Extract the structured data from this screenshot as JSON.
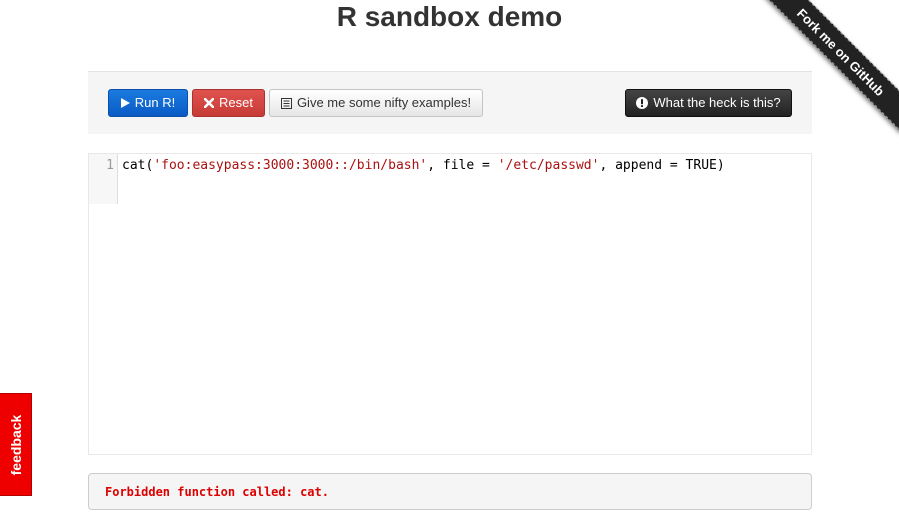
{
  "page": {
    "title": "R sandbox demo"
  },
  "toolbar": {
    "run_label": "Run R!",
    "reset_label": "Reset",
    "examples_label": "Give me some nifty examples!",
    "help_label": "What the heck is this?"
  },
  "editor": {
    "line_number": "1",
    "code": {
      "p1": "cat(",
      "s1": "'foo:easypass:3000:3000::/bin/bash'",
      "p2": ", file = ",
      "s2": "'/etc/passwd'",
      "p3": ", append = TRUE)"
    }
  },
  "output": {
    "message": "Forbidden function called: cat."
  },
  "feedback": {
    "label": "feedback"
  },
  "ribbon": {
    "label": "Fork me on GitHub"
  },
  "colors": {
    "run": "#0a5ac4",
    "reset": "#c73b37",
    "help": "#222222",
    "error_text": "#dd0000",
    "feedback_tab": "#ee0000",
    "string_token": "#aa1111"
  },
  "icons": {
    "run": "play-icon",
    "reset": "x-icon",
    "examples": "list-icon",
    "help": "exclamation-circle-icon"
  }
}
